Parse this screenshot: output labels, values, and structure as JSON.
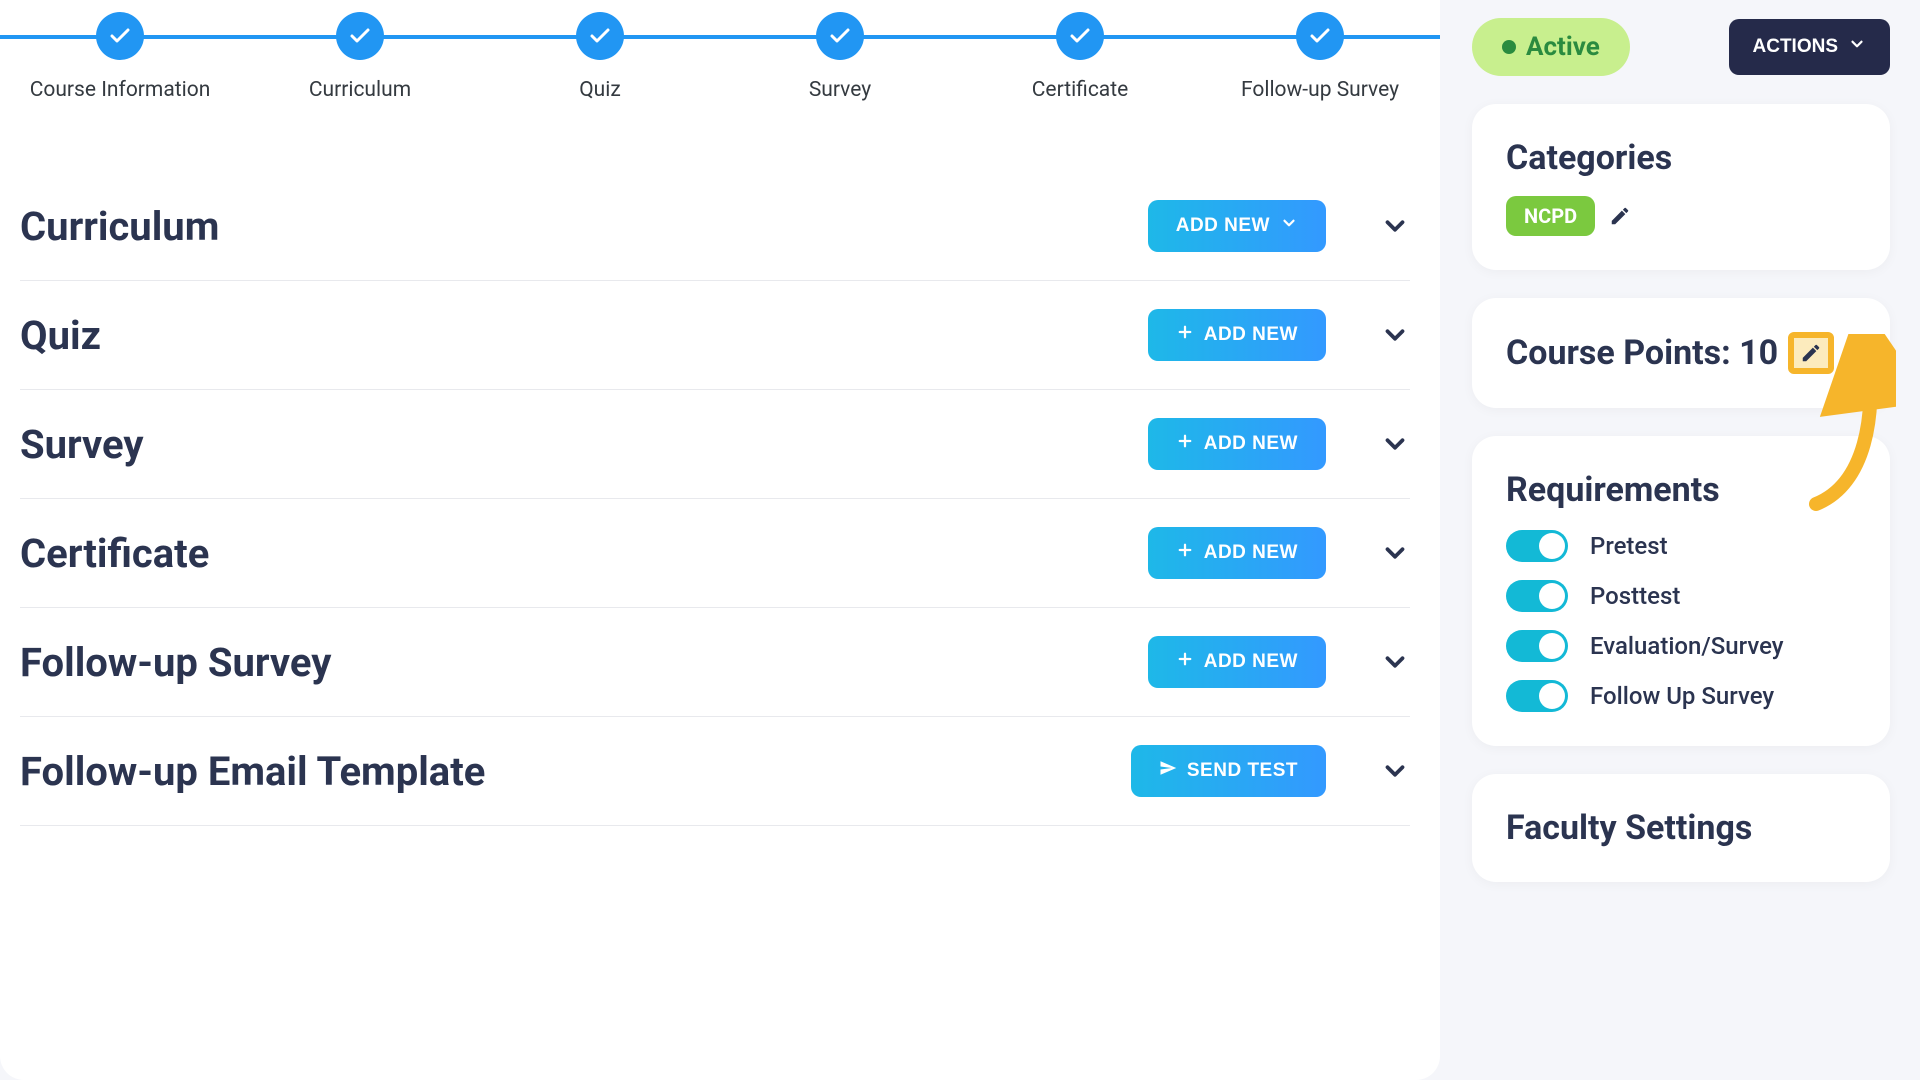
{
  "stepper": {
    "steps": [
      {
        "label": "Course Information"
      },
      {
        "label": "Curriculum"
      },
      {
        "label": "Quiz"
      },
      {
        "label": "Survey"
      },
      {
        "label": "Certificate"
      },
      {
        "label": "Follow-up Survey"
      }
    ]
  },
  "sections": [
    {
      "title": "Curriculum",
      "button": "ADD NEW",
      "icon": "chevron"
    },
    {
      "title": "Quiz",
      "button": "ADD NEW",
      "icon": "plus"
    },
    {
      "title": "Survey",
      "button": "ADD NEW",
      "icon": "plus"
    },
    {
      "title": "Certificate",
      "button": "ADD NEW",
      "icon": "plus"
    },
    {
      "title": "Follow-up Survey",
      "button": "ADD NEW",
      "icon": "plus"
    },
    {
      "title": "Follow-up Email Template",
      "button": "SEND TEST",
      "icon": "send"
    }
  ],
  "sidebar": {
    "status": "Active",
    "actions_label": "ACTIONS",
    "categories_title": "Categories",
    "category_tag": "NCPD",
    "points_label": "Course Points: 10",
    "requirements_title": "Requirements",
    "requirements": [
      {
        "label": "Pretest",
        "on": true
      },
      {
        "label": "Posttest",
        "on": true
      },
      {
        "label": "Evaluation/Survey",
        "on": true
      },
      {
        "label": "Follow Up Survey",
        "on": true
      }
    ],
    "faculty_title": "Faculty Settings"
  }
}
